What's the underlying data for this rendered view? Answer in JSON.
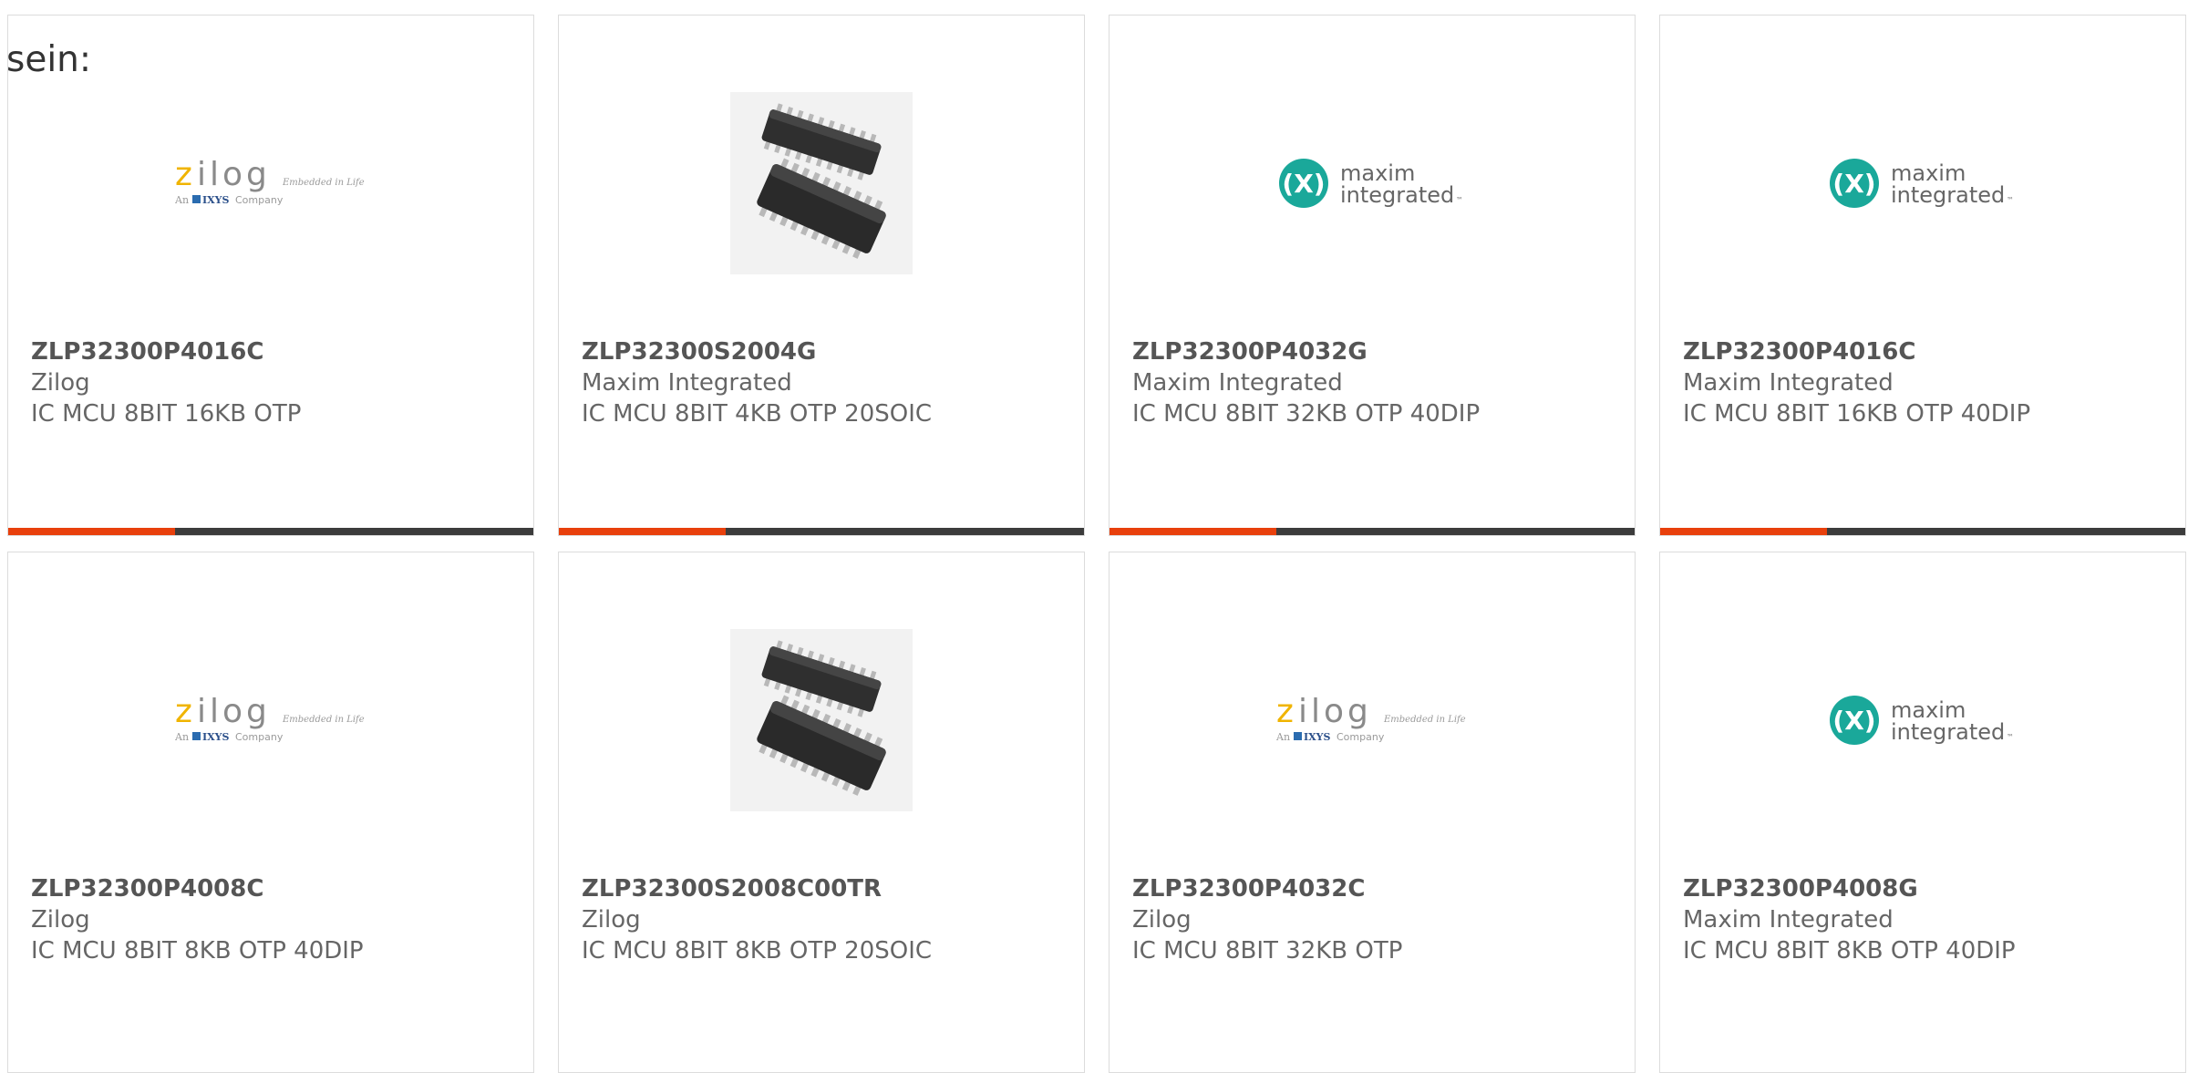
{
  "intro_text": "sein:",
  "colors": {
    "accent": "#e8400c",
    "bar": "#3c3c3c",
    "border": "#dcdcdc",
    "zilog_yellow": "#f0b400",
    "maxim_teal": "#1aa89a"
  },
  "cards": [
    {
      "part_number": "ZLP32300P4016C",
      "manufacturer": "Zilog",
      "description": "IC MCU 8BIT 16KB OTP",
      "image": "zilog-logo",
      "logo_text": {
        "word": "zilog",
        "tagline": "Embedded in Life",
        "sub_prefix": "An",
        "sub_brand": "IXYS",
        "sub_suffix": "Company"
      }
    },
    {
      "part_number": "ZLP32300S2004G",
      "manufacturer": "Maxim Integrated",
      "description": "IC MCU 8BIT 4KB OTP 20SOIC",
      "image": "chip-photo"
    },
    {
      "part_number": "ZLP32300P4032G",
      "manufacturer": "Maxim Integrated",
      "description": "IC MCU 8BIT 32KB OTP 40DIP",
      "image": "maxim-logo",
      "logo_text": {
        "line1": "maxim",
        "line2": "integrated",
        "tm": "™"
      }
    },
    {
      "part_number": "ZLP32300P4016C",
      "manufacturer": "Maxim Integrated",
      "description": "IC MCU 8BIT 16KB OTP 40DIP",
      "image": "maxim-logo",
      "logo_text": {
        "line1": "maxim",
        "line2": "integrated",
        "tm": "™"
      }
    },
    {
      "part_number": "ZLP32300P4008C",
      "manufacturer": "Zilog",
      "description": "IC MCU 8BIT 8KB OTP 40DIP",
      "image": "zilog-logo",
      "logo_text": {
        "word": "zilog",
        "tagline": "Embedded in Life",
        "sub_prefix": "An",
        "sub_brand": "IXYS",
        "sub_suffix": "Company"
      }
    },
    {
      "part_number": "ZLP32300S2008C00TR",
      "manufacturer": "Zilog",
      "description": "IC MCU 8BIT 8KB OTP 20SOIC",
      "image": "chip-photo"
    },
    {
      "part_number": "ZLP32300P4032C",
      "manufacturer": "Zilog",
      "description": "IC MCU 8BIT 32KB OTP",
      "image": "zilog-logo",
      "logo_text": {
        "word": "zilog",
        "tagline": "Embedded in Life",
        "sub_prefix": "An",
        "sub_brand": "IXYS",
        "sub_suffix": "Company"
      }
    },
    {
      "part_number": "ZLP32300P4008G",
      "manufacturer": "Maxim Integrated",
      "description": "IC MCU 8BIT 8KB OTP 40DIP",
      "image": "maxim-logo",
      "logo_text": {
        "line1": "maxim",
        "line2": "integrated",
        "tm": "™"
      }
    }
  ]
}
